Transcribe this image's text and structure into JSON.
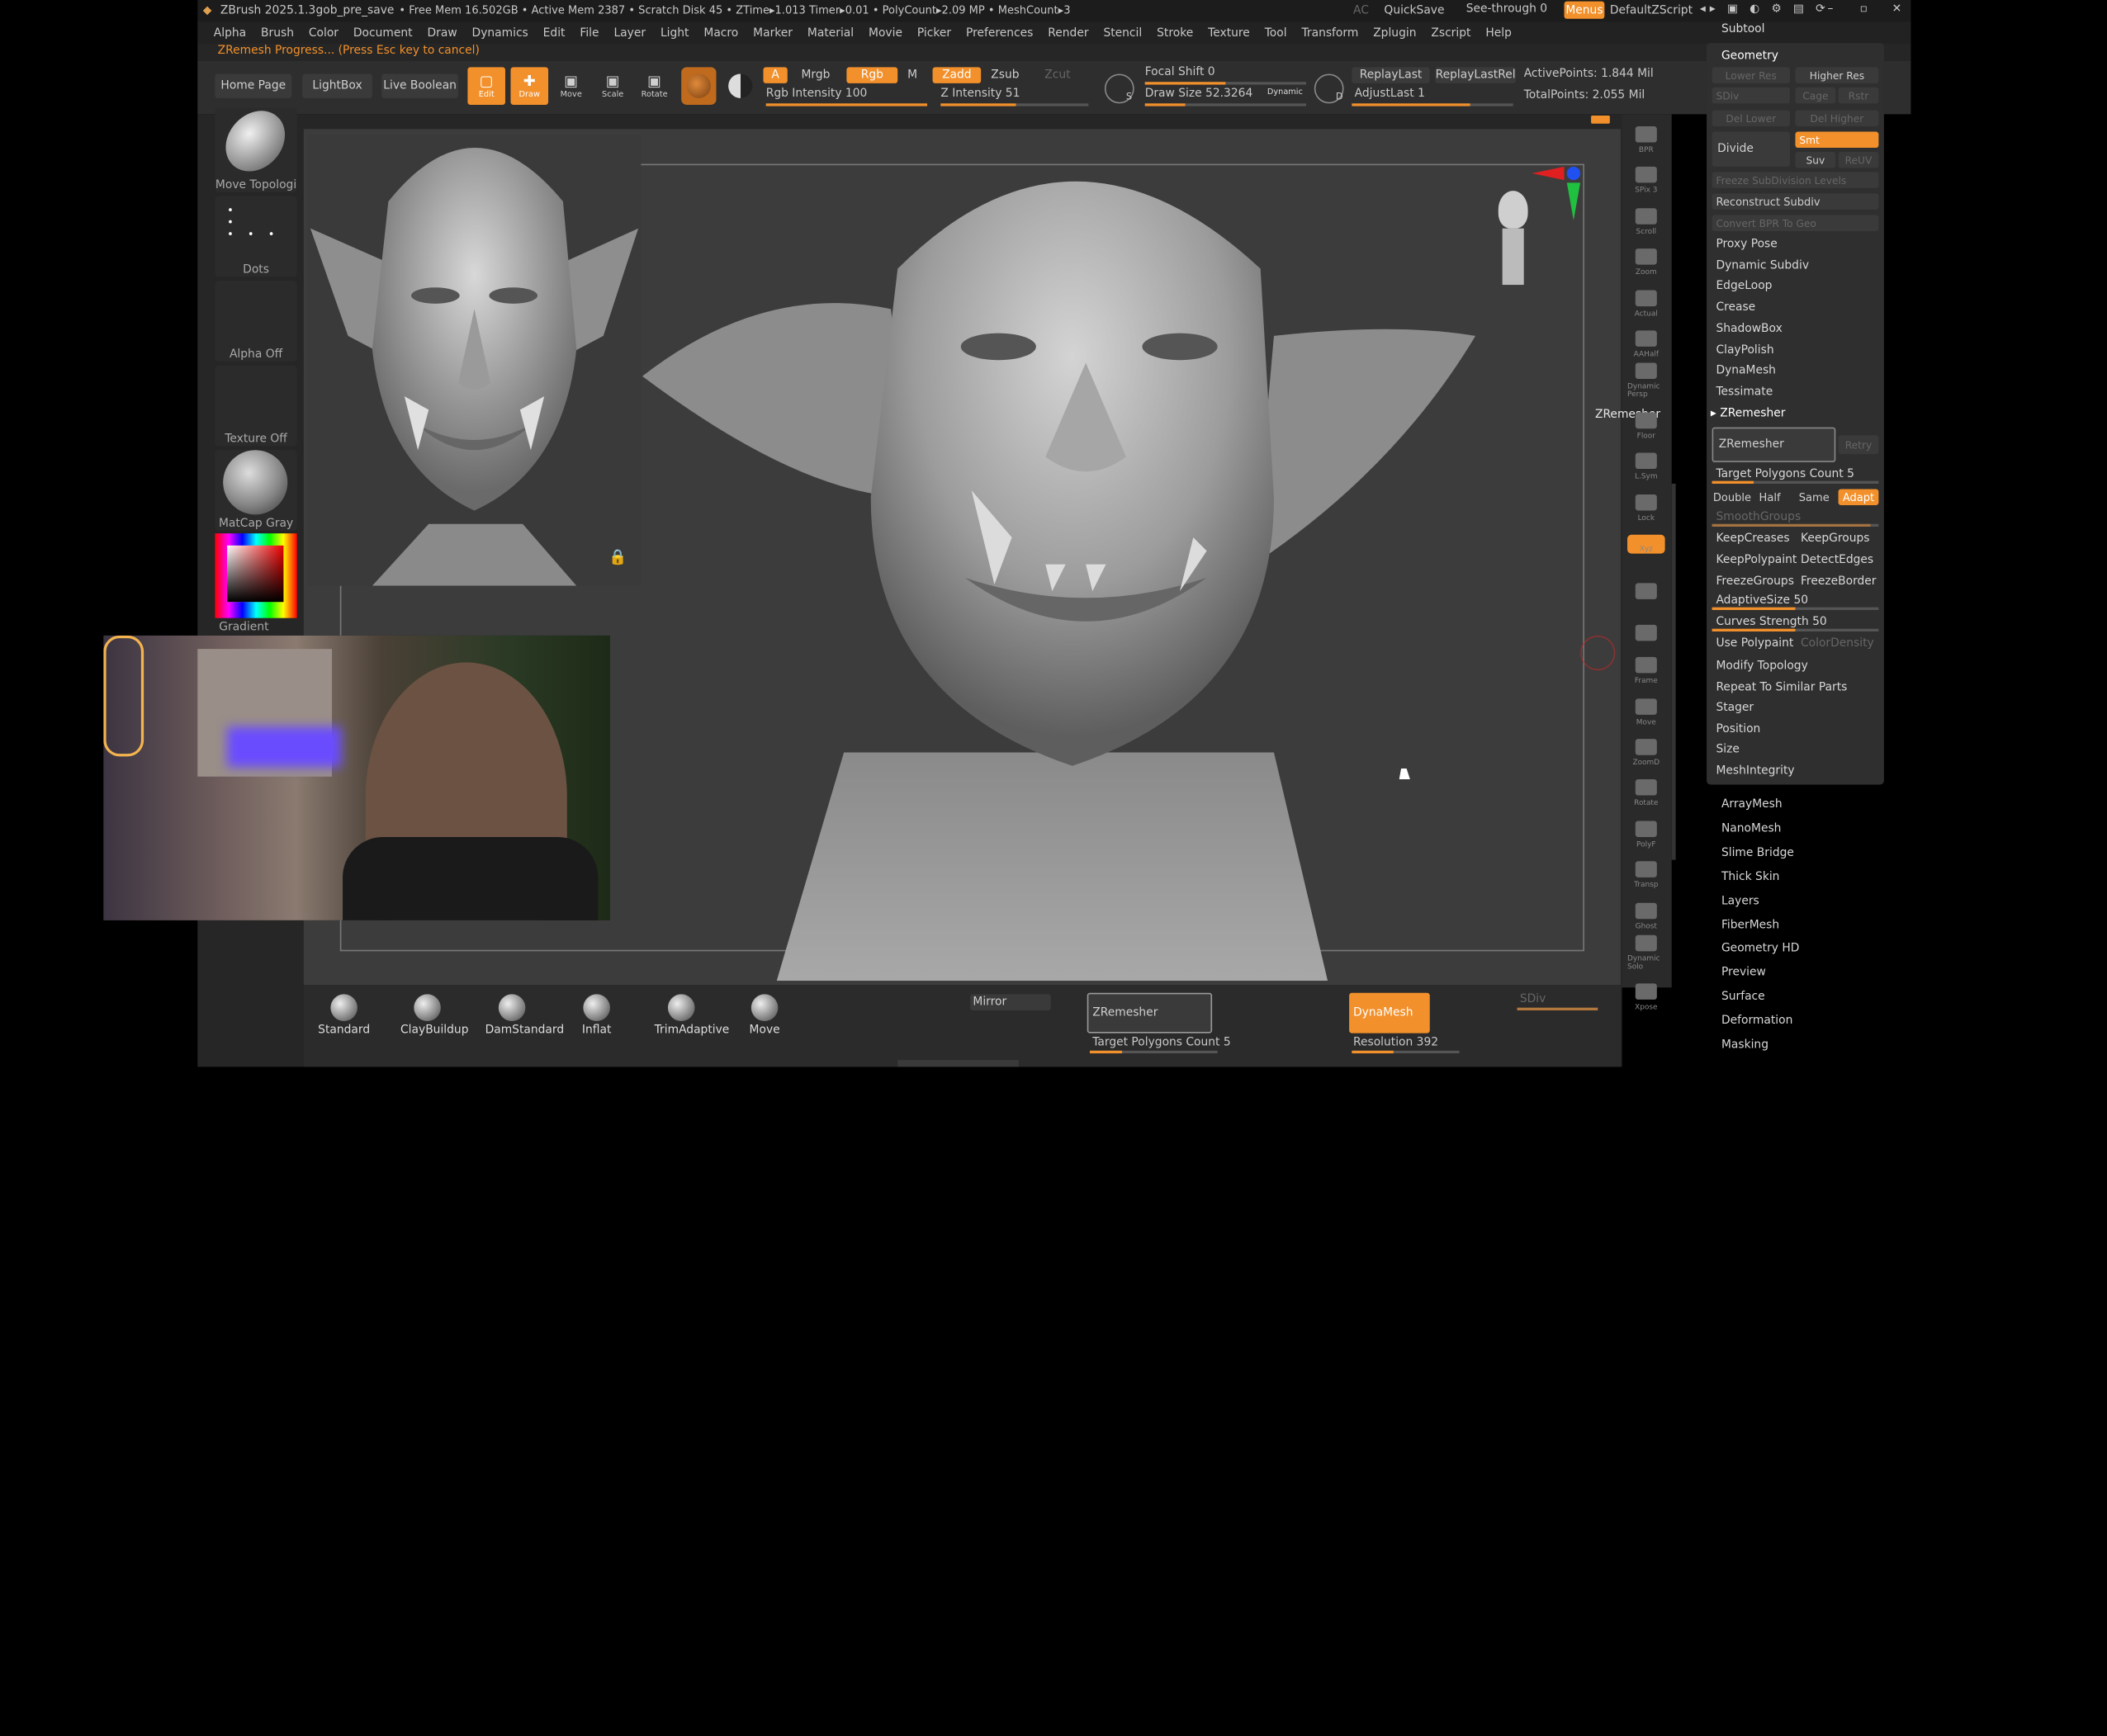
{
  "title_bar": {
    "app": "ZBrush 2025.1.3",
    "file": "gob_pre_save",
    "stats": "• Free Mem 16.502GB • Active Mem 2387 • Scratch Disk 45 • ZTime▸1.013 Timer▸0.01 • PolyCount▸2.09 MP • MeshCount▸3",
    "ac": "AC",
    "quicksave": "QuickSave",
    "see_through": "See-through  0",
    "menus": "Menus",
    "script": "DefaultZScript"
  },
  "menu": [
    "Alpha",
    "Brush",
    "Color",
    "Document",
    "Draw",
    "Dynamics",
    "Edit",
    "File",
    "Layer",
    "Light",
    "Macro",
    "Marker",
    "Material",
    "Movie",
    "Picker",
    "Preferences",
    "Render",
    "Stencil",
    "Stroke",
    "Texture",
    "Tool",
    "Transform",
    "Zplugin",
    "Zscript",
    "Help"
  ],
  "status": "ZRemesh Progress... (Press Esc key to cancel)",
  "toolbar": {
    "home": "Home Page",
    "lightbox": "LightBox",
    "live_boolean": "Live Boolean",
    "edit": "Edit",
    "draw": "Draw",
    "move": "Move",
    "scale": "Scale",
    "rotate": "Rotate",
    "a": "A",
    "mrgb": "Mrgb",
    "rgb": "Rgb",
    "m": "M",
    "zadd": "Zadd",
    "zsub": "Zsub",
    "zcut": "Zcut",
    "rgb_intensity": "Rgb Intensity 100",
    "z_intensity": "Z Intensity 51",
    "focal_shift": "Focal Shift 0",
    "draw_size": "Draw Size 52.3264",
    "dynamic": "Dynamic",
    "replay_last": "ReplayLast",
    "replay_last_rel": "ReplayLastRel",
    "adjust_last": "AdjustLast 1",
    "active_points": "ActivePoints: 1.844 Mil",
    "total_points": "TotalPoints: 2.055 Mil",
    "s": "S",
    "d": "D",
    "rgb_intensity_value": 100,
    "z_intensity_value": 51,
    "focal_shift_value": 0,
    "adjust_last_value": 1
  },
  "left": {
    "brush": "Move Topologi",
    "stroke": "Dots",
    "alpha": "Alpha Off",
    "texture": "Texture Off",
    "material": "MatCap Gray",
    "gradient": "Gradient"
  },
  "right_shelf": [
    "BPR",
    "SPix 3",
    "Scroll",
    "Zoom",
    "Actual",
    "AAHalf",
    "Dynamic Persp",
    "Floor",
    "L.Sym",
    "Lock",
    "Xyz",
    "",
    "",
    "Frame",
    "Move",
    "ZoomD",
    "Rotate",
    "PolyF",
    "Transp",
    "Ghost",
    "Dynamic Solo",
    "Xpose"
  ],
  "zremesher_popup": "ZRemesher",
  "panel": {
    "subtool": "Subtool",
    "geometry": "Geometry",
    "lower_res": "Lower Res",
    "higher_res": "Higher Res",
    "sdiv": "SDiv",
    "cage": "Cage",
    "rstr": "Rstr",
    "del_lower": "Del Lower",
    "del_higher": "Del Higher",
    "divide": "Divide",
    "smt": "Smt",
    "suv": "Suv",
    "reuv": "ReUV",
    "freeze_subdiv": "Freeze SubDivision Levels",
    "reconstruct": "Reconstruct Subdiv",
    "convert_bpr": "Convert BPR To Geo",
    "items": [
      "Proxy Pose",
      "Dynamic Subdiv",
      "EdgeLoop",
      "Crease",
      "ShadowBox",
      "ClayPolish",
      "DynaMesh",
      "Tessimate"
    ],
    "zremesher_section": "▸ ZRemesher",
    "zremesher_btn": "ZRemesher",
    "retry": "Retry",
    "target_poly": "Target Polygons Count 5",
    "target_poly_value": 5,
    "double": "Double",
    "half": "Half",
    "same": "Same",
    "adapt": "Adapt",
    "smooth_groups": "SmoothGroups",
    "keep_creases": "KeepCreases",
    "keep_groups": "KeepGroups",
    "keep_polypaint": "KeepPolypaint",
    "detect_edges": "DetectEdges",
    "freeze_groups": "FreezeGroups",
    "freeze_border": "FreezeBorder",
    "adaptive_size": "AdaptiveSize 50",
    "adaptive_size_value": 50,
    "curves_strength": "Curves Strength 50",
    "curves_strength_value": 50,
    "use_polypaint": "Use Polypaint",
    "color_density": "ColorDensity",
    "rest": [
      "Modify Topology",
      "Repeat To Similar Parts",
      "Stager",
      "Position",
      "Size",
      "MeshIntegrity"
    ]
  },
  "subpalettes": [
    "ArrayMesh",
    "NanoMesh",
    "Slime Bridge",
    "Thick Skin",
    "Layers",
    "FiberMesh",
    "Geometry HD",
    "Preview",
    "Surface",
    "Deformation",
    "Masking"
  ],
  "bottom": {
    "brushes": [
      "Standard",
      "ClayBuildup",
      "DamStandard",
      "Inflat",
      "TrimAdaptive",
      "Move"
    ],
    "mirror": "Mirror",
    "zremesher": "ZRemesher",
    "target": "Target Polygons Count 5",
    "dynamesh": "DynaMesh",
    "resolution": "Resolution 392",
    "sdiv": "SDiv",
    "resolution_value": 392
  },
  "colors": {
    "accent": "#f2902b",
    "panel": "#2b2b2b",
    "canvas": "#3c3c3c"
  }
}
